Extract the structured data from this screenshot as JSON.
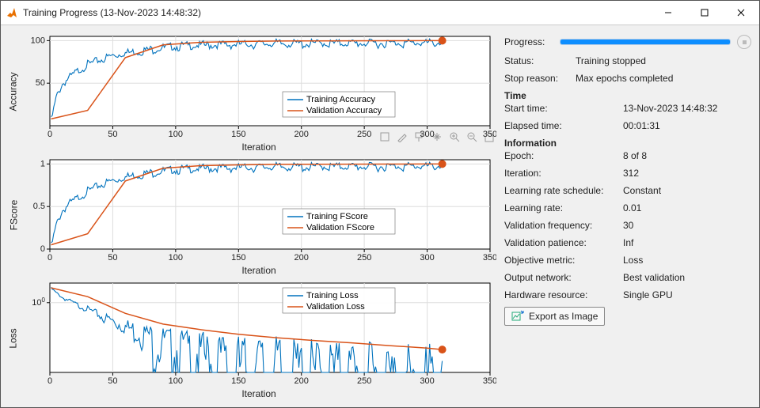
{
  "window": {
    "title": "Training Progress (13-Nov-2023 14:48:32)"
  },
  "charts": {
    "accuracy": {
      "ylabel": "Accuracy",
      "xlabel": "Iteration",
      "legend_train": "Training Accuracy",
      "legend_valid": "Validation Accuracy",
      "yticks": [
        "50",
        "100"
      ]
    },
    "fscore": {
      "ylabel": "FScore",
      "xlabel": "Iteration",
      "legend_train": "Training FScore",
      "legend_valid": "Validation FScore",
      "yticks": [
        "0",
        "0.5",
        "1"
      ]
    },
    "loss": {
      "ylabel": "Loss",
      "xlabel": "Iteration",
      "legend_train": "Training Loss",
      "legend_valid": "Validation Loss",
      "yticks_html": "10<tspan baseline-shift=\"super\" font-size=\"8\">0</tspan>"
    },
    "xticks": [
      "0",
      "50",
      "100",
      "150",
      "200",
      "250",
      "300",
      "350"
    ]
  },
  "progress_label": "Progress:",
  "progress_pct": 100,
  "status_label": "Status:",
  "status_value": "Training stopped",
  "stop_label": "Stop reason:",
  "stop_value": "Max epochs completed",
  "time_hdr": "Time",
  "start_label": "Start time:",
  "start_value": "13-Nov-2023 14:48:32",
  "elapsed_label": "Elapsed time:",
  "elapsed_value": "00:01:31",
  "info_hdr": "Information",
  "epoch_label": "Epoch:",
  "epoch_value": "8 of 8",
  "iter_label": "Iteration:",
  "iter_value": "312",
  "lrs_label": "Learning rate schedule:",
  "lrs_value": "Constant",
  "lr_label": "Learning rate:",
  "lr_value": "0.01",
  "vf_label": "Validation frequency:",
  "vf_value": "30",
  "vp_label": "Validation patience:",
  "vp_value": "Inf",
  "om_label": "Objective metric:",
  "om_value": "Loss",
  "on_label": "Output network:",
  "on_value": "Best validation",
  "hw_label": "Hardware resource:",
  "hw_value": "Single GPU",
  "export_label": "Export as Image",
  "chart_data": [
    {
      "type": "line",
      "title": "Accuracy",
      "xlabel": "Iteration",
      "ylabel": "Accuracy",
      "xlim": [
        0,
        350
      ],
      "ylim": [
        0,
        100
      ],
      "series": [
        {
          "name": "Training Accuracy",
          "x": [
            1,
            5,
            10,
            15,
            20,
            25,
            30,
            40,
            50,
            60,
            70,
            80,
            90,
            100,
            120,
            140,
            160,
            180,
            200,
            220,
            240,
            260,
            280,
            300,
            312
          ],
          "values": [
            8,
            35,
            52,
            58,
            64,
            70,
            74,
            80,
            85,
            88,
            90,
            92,
            94,
            96,
            97,
            98,
            98.5,
            99,
            99,
            99.3,
            99.5,
            99.6,
            99.7,
            99.8,
            99.8
          ]
        },
        {
          "name": "Validation Accuracy",
          "x": [
            1,
            30,
            60,
            90,
            120,
            150,
            180,
            210,
            240,
            270,
            300,
            312
          ],
          "values": [
            8,
            18,
            80,
            95,
            98,
            99,
            99.5,
            99.7,
            99.8,
            99.9,
            100,
            100
          ]
        }
      ]
    },
    {
      "type": "line",
      "title": "FScore",
      "xlabel": "Iteration",
      "ylabel": "FScore",
      "xlim": [
        0,
        350
      ],
      "ylim": [
        0,
        1
      ],
      "series": [
        {
          "name": "Training FScore",
          "x": [
            1,
            5,
            10,
            15,
            20,
            25,
            30,
            40,
            50,
            60,
            70,
            80,
            90,
            100,
            120,
            140,
            160,
            180,
            200,
            220,
            240,
            260,
            280,
            300,
            312
          ],
          "values": [
            0.05,
            0.3,
            0.48,
            0.55,
            0.6,
            0.66,
            0.7,
            0.78,
            0.83,
            0.87,
            0.9,
            0.92,
            0.94,
            0.96,
            0.97,
            0.98,
            0.985,
            0.99,
            0.99,
            0.993,
            0.995,
            0.996,
            0.997,
            0.998,
            0.998
          ]
        },
        {
          "name": "Validation FScore",
          "x": [
            1,
            30,
            60,
            90,
            120,
            150,
            180,
            210,
            240,
            270,
            300,
            312
          ],
          "values": [
            0.05,
            0.18,
            0.8,
            0.95,
            0.98,
            0.99,
            0.995,
            0.997,
            0.998,
            0.999,
            1.0,
            1.0
          ]
        }
      ]
    },
    {
      "type": "line",
      "title": "Loss",
      "xlabel": "Iteration",
      "ylabel": "Loss",
      "xlim": [
        0,
        350
      ],
      "yscale": "log",
      "ylim": [
        0.02,
        3
      ],
      "series": [
        {
          "name": "Training Loss",
          "x": [
            1,
            5,
            10,
            20,
            30,
            40,
            50,
            60,
            80,
            100,
            120,
            140,
            160,
            180,
            200,
            220,
            240,
            260,
            280,
            300,
            312
          ],
          "values": [
            2.3,
            1.8,
            1.4,
            1.0,
            0.75,
            0.55,
            0.42,
            0.33,
            0.22,
            0.16,
            0.12,
            0.1,
            0.085,
            0.075,
            0.065,
            0.058,
            0.052,
            0.047,
            0.043,
            0.04,
            0.038
          ]
        },
        {
          "name": "Validation Loss",
          "x": [
            1,
            30,
            60,
            90,
            120,
            150,
            180,
            210,
            240,
            270,
            300,
            312
          ],
          "values": [
            2.3,
            1.4,
            0.55,
            0.3,
            0.22,
            0.17,
            0.14,
            0.12,
            0.105,
            0.09,
            0.078,
            0.072
          ]
        }
      ]
    }
  ]
}
